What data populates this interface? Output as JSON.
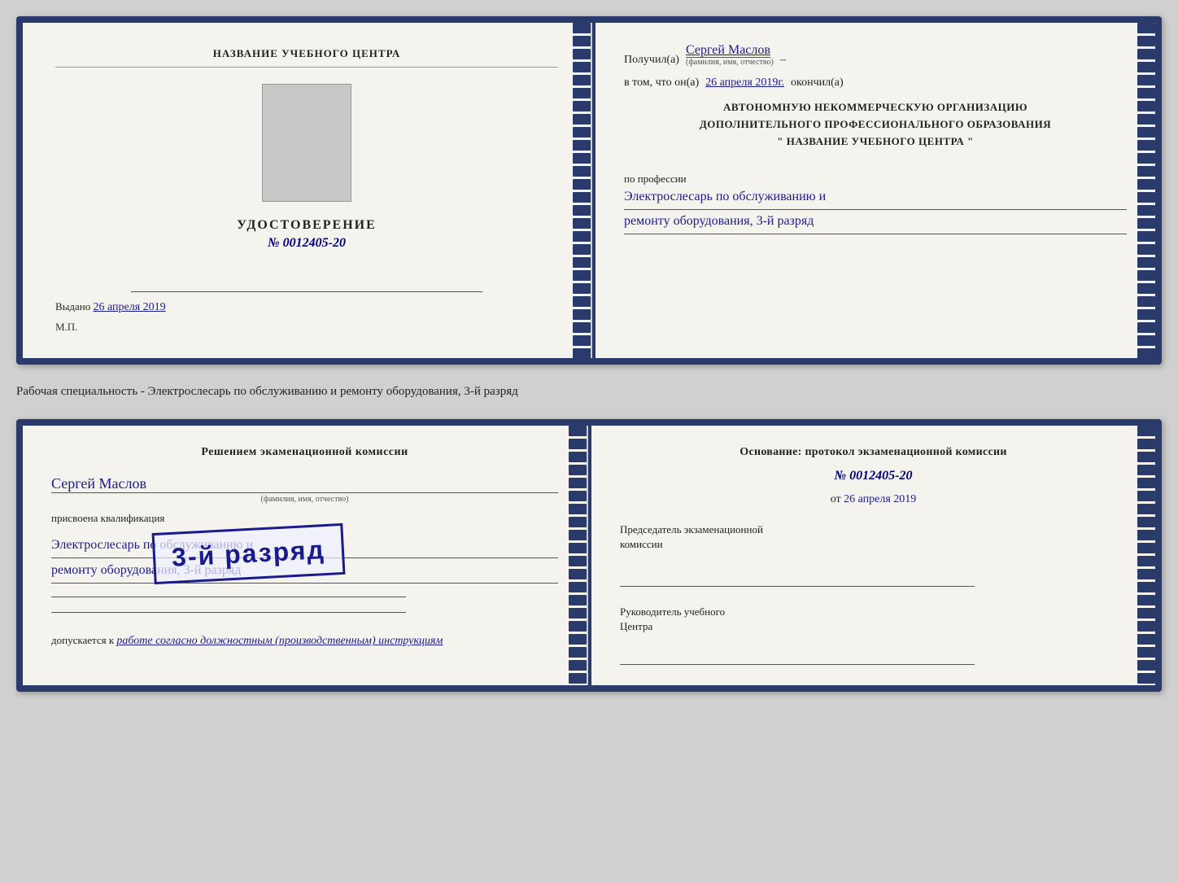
{
  "cert1": {
    "left": {
      "org_name": "НАЗВАНИЕ УЧЕБНОГО ЦЕНТРА",
      "cert_title": "УДОСТОВЕРЕНИЕ",
      "cert_number": "№ 0012405-20",
      "issued_label": "Выдано",
      "issued_date": "26 апреля 2019",
      "mp_label": "М.П."
    },
    "right": {
      "received_label": "Получил(а)",
      "recipient_name": "Сергей Маслов",
      "recipient_sub": "(фамилия, имя, отчество)",
      "in_that_label": "в том, что он(а)",
      "completed_date": "26 апреля 2019г.",
      "completed_label": "окончил(а)",
      "org_line1": "АВТОНОМНУЮ НЕКОММЕРЧЕСКУЮ ОРГАНИЗАЦИЮ",
      "org_line2": "ДОПОЛНИТЕЛЬНОГО ПРОФЕССИОНАЛЬНОГО ОБРАЗОВАНИЯ",
      "org_line3": "\"   НАЗВАНИЕ УЧЕБНОГО ЦЕНТРА   \"",
      "profession_label": "по профессии",
      "profession_line1": "Электрослесарь по обслуживанию и",
      "profession_line2": "ремонту оборудования, 3-й разряд"
    }
  },
  "between_text": "Рабочая специальность - Электрослесарь по обслуживанию и ремонту оборудования, 3-й разряд",
  "cert2": {
    "left": {
      "decision_title": "Решением экаменационной комиссии",
      "person_name": "Сергей Маслов",
      "person_sub": "(фамилия, имя, отчество)",
      "assigned_text": "присвоена квалификация",
      "qualification_line1": "Электрослесарь по обслуживанию и",
      "qualification_line2": "ремонту оборудования, 3-й разряд",
      "admitted_label": "допускается к",
      "admitted_text": "работе согласно должностным (производственным) инструкциям"
    },
    "right": {
      "basis_text": "Основание: протокол экзаменационной комиссии",
      "protocol_number": "№  0012405-20",
      "date_prefix": "от",
      "date_value": "26 апреля 2019",
      "chairman_line1": "Председатель экзаменационной",
      "chairman_line2": "комиссии",
      "director_line1": "Руководитель учебного",
      "director_line2": "Центра"
    },
    "stamp_text": "3-й разряд"
  }
}
